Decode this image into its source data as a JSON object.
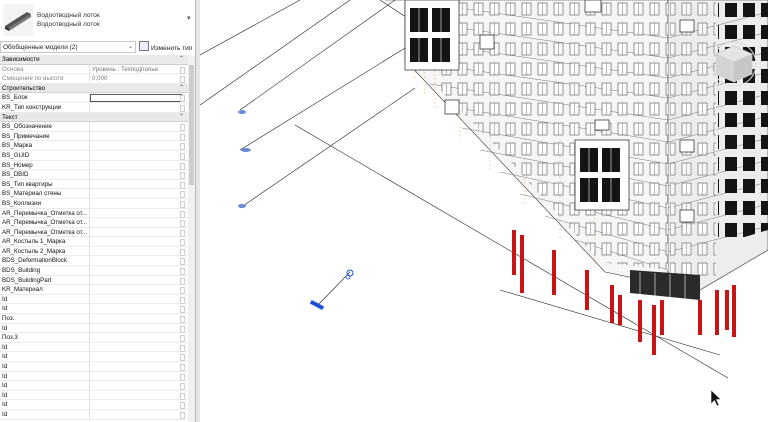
{
  "type_selector": {
    "name": "Водоотводный лоток",
    "subname": "Водоотводный лоток",
    "thumb_icon": "gutter-tray-thumbnail-icon"
  },
  "filter": {
    "selected": "Обобщенные модели (2)",
    "edit_type_label": "Изменить тип"
  },
  "groups": [
    {
      "title": "Зависимости",
      "rows": [
        {
          "label": "Основа",
          "value": "Уровень : Техподполье",
          "dim": true
        },
        {
          "label": "Смещение по высоте",
          "value": "0,000",
          "dim": true
        }
      ]
    },
    {
      "title": "Строительство",
      "rows": [
        {
          "label": "BS_Блок",
          "value": "",
          "editing": true
        },
        {
          "label": "KR_Тип конструкции",
          "value": ""
        }
      ]
    },
    {
      "title": "Текст",
      "rows": [
        {
          "label": "BS_Обозначение",
          "value": ""
        },
        {
          "label": "BS_Примечание",
          "value": ""
        },
        {
          "label": "BS_Марка",
          "value": ""
        },
        {
          "label": "BS_GUID",
          "value": ""
        },
        {
          "label": "BS_Номер",
          "value": ""
        },
        {
          "label": "BS_DBID",
          "value": ""
        },
        {
          "label": "BS_Тип квартиры",
          "value": ""
        },
        {
          "label": "BS_Материал стены",
          "value": ""
        },
        {
          "label": "BS_Коллизии",
          "value": ""
        },
        {
          "label": "AR_Перемычка_Отметка от...",
          "value": ""
        },
        {
          "label": "AR_Перемычка_Отметка от...",
          "value": ""
        },
        {
          "label": "AR_Перемычка_Отметка от...",
          "value": ""
        },
        {
          "label": "AR_Костыль 1_Марка",
          "value": ""
        },
        {
          "label": "AR_Костыль 2_Марка",
          "value": ""
        },
        {
          "label": "BDS_DeformationBlock",
          "value": ""
        },
        {
          "label": "BDS_Building",
          "value": ""
        },
        {
          "label": "BDS_BuildingPart",
          "value": ""
        },
        {
          "label": "KR_Материал",
          "value": ""
        },
        {
          "label": "Id",
          "value": ""
        },
        {
          "label": "Id",
          "value": ""
        },
        {
          "label": "Поз.",
          "value": ""
        },
        {
          "label": "Id",
          "value": ""
        },
        {
          "label": "Поз.3",
          "value": ""
        },
        {
          "label": "Id",
          "value": ""
        },
        {
          "label": "Id",
          "value": ""
        },
        {
          "label": "Id",
          "value": ""
        },
        {
          "label": "Id",
          "value": ""
        },
        {
          "label": "Id",
          "value": ""
        },
        {
          "label": "Id",
          "value": ""
        },
        {
          "label": "Id",
          "value": ""
        },
        {
          "label": "Id",
          "value": ""
        }
      ]
    }
  ],
  "colors": {
    "selection_blue": "#1a4fd6",
    "pile_red": "#c81414",
    "grid_orange": "#e8a040",
    "window_dark": "#141414"
  },
  "view": {
    "navigation_icon": "view-cube-icon",
    "cursor_icon": "mouse-pointer-icon"
  }
}
